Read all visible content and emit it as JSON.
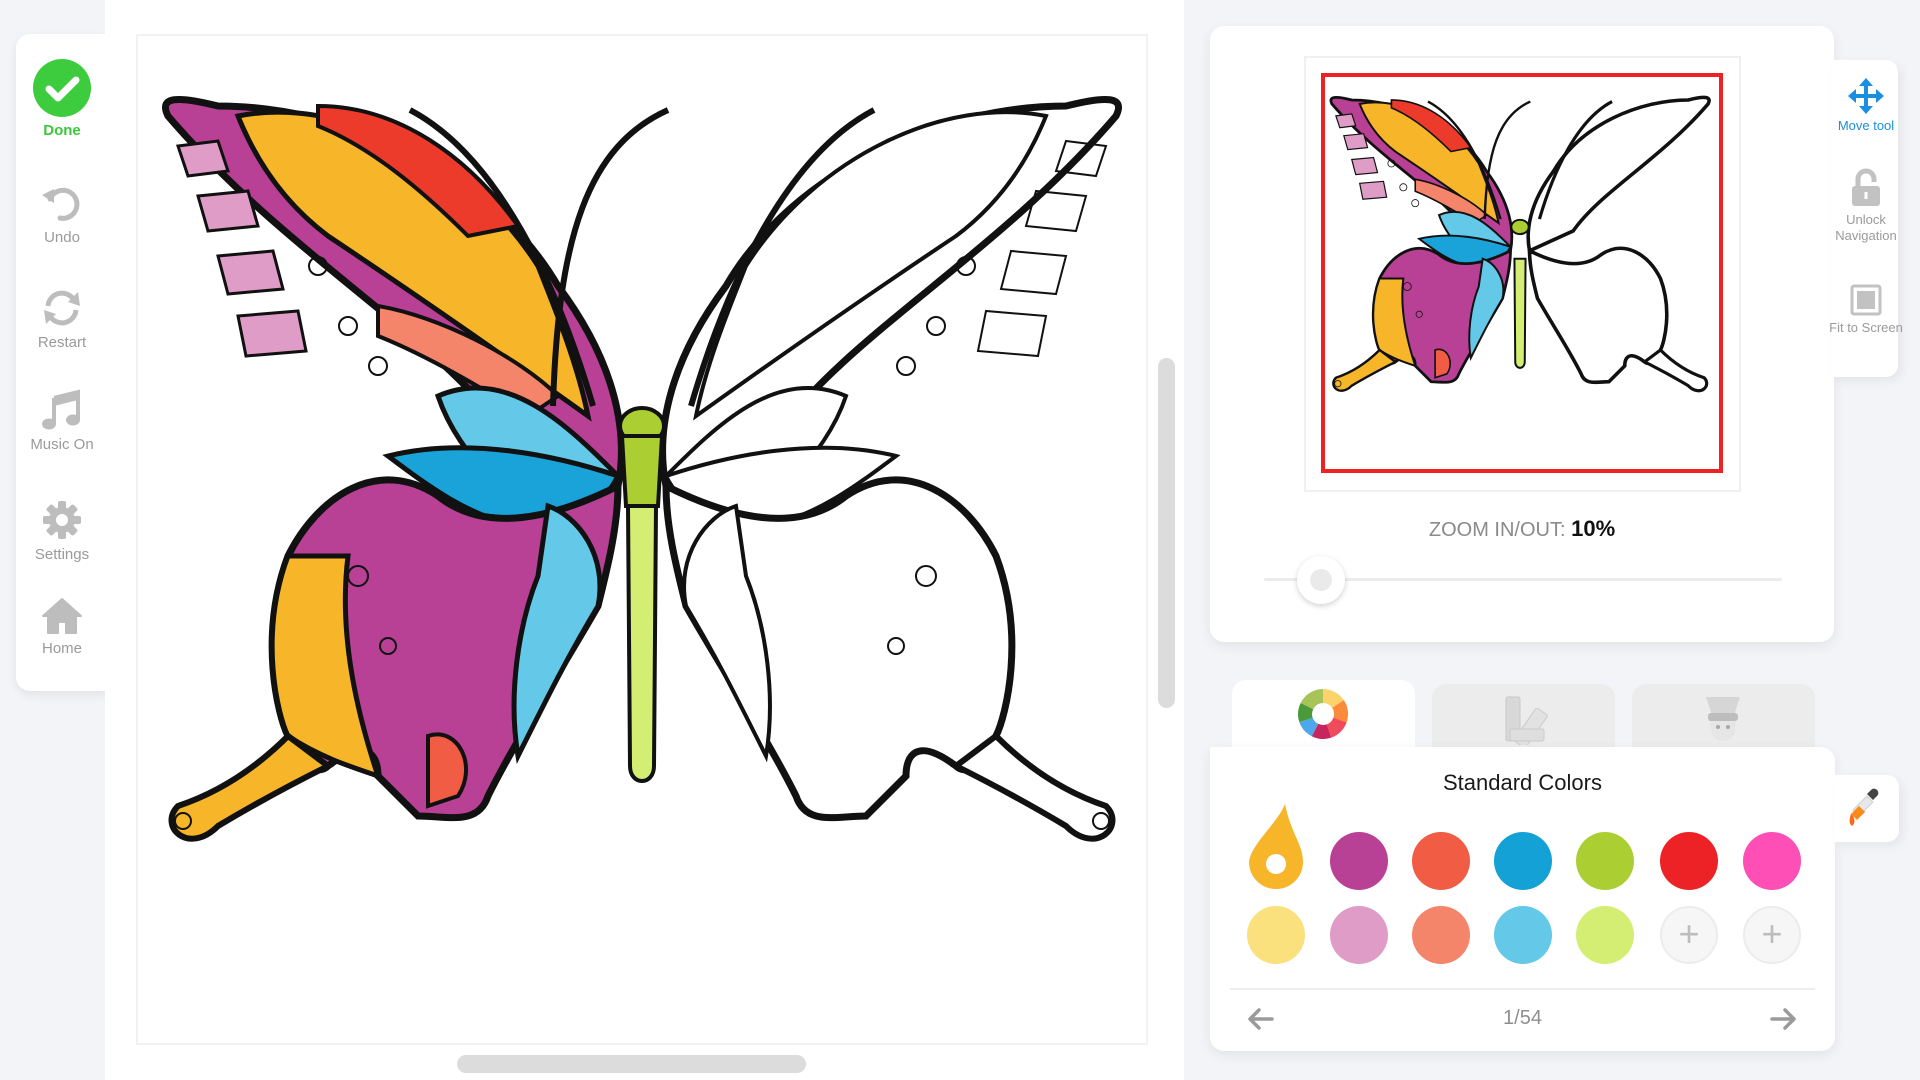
{
  "sidebar": {
    "items": [
      {
        "label": "Done",
        "icon": "checkmark-icon",
        "color": "#3cc63c"
      },
      {
        "label": "Undo",
        "icon": "undo-icon"
      },
      {
        "label": "Restart",
        "icon": "restart-icon"
      },
      {
        "label": "Music On",
        "icon": "music-note-icon"
      },
      {
        "label": "Settings",
        "icon": "gear-icon"
      },
      {
        "label": "Home",
        "icon": "home-icon"
      }
    ]
  },
  "canvas": {
    "artwork": "butterfly",
    "colored_portion": "left wing"
  },
  "navigator": {
    "zoom_label": "ZOOM IN/OUT:",
    "zoom_value": "10%",
    "zoom_percent": 10,
    "viewport_color": "#ee2222"
  },
  "tools": [
    {
      "label": "Move tool",
      "icon": "move-arrows-icon",
      "active": true,
      "color": "#1a8fe0"
    },
    {
      "label": "Unlock Navigation",
      "icon": "unlock-icon"
    },
    {
      "label": "Fit to Screen",
      "icon": "fit-screen-icon"
    }
  ],
  "palette": {
    "tabs": [
      {
        "name": "color-wheel",
        "icon": "color-wheel-icon",
        "active": true
      },
      {
        "name": "swatch-book",
        "icon": "swatch-book-icon",
        "active": false
      },
      {
        "name": "character",
        "icon": "character-icon",
        "active": false
      }
    ],
    "title": "Standard Colors",
    "selected_color": "#f7b52a",
    "row1": [
      "#f7b52a",
      "#b84095",
      "#f05c44",
      "#14a1d6",
      "#abcf33",
      "#ec2227",
      "#fd4fb6"
    ],
    "row2": [
      "#fbe07e",
      "#df9cc7",
      "#f4856b",
      "#64c9e8",
      "#d3ee72",
      "add",
      "add"
    ],
    "add_label": "+",
    "page": "1/54",
    "eyedropper_icon": "eyedropper-icon"
  }
}
